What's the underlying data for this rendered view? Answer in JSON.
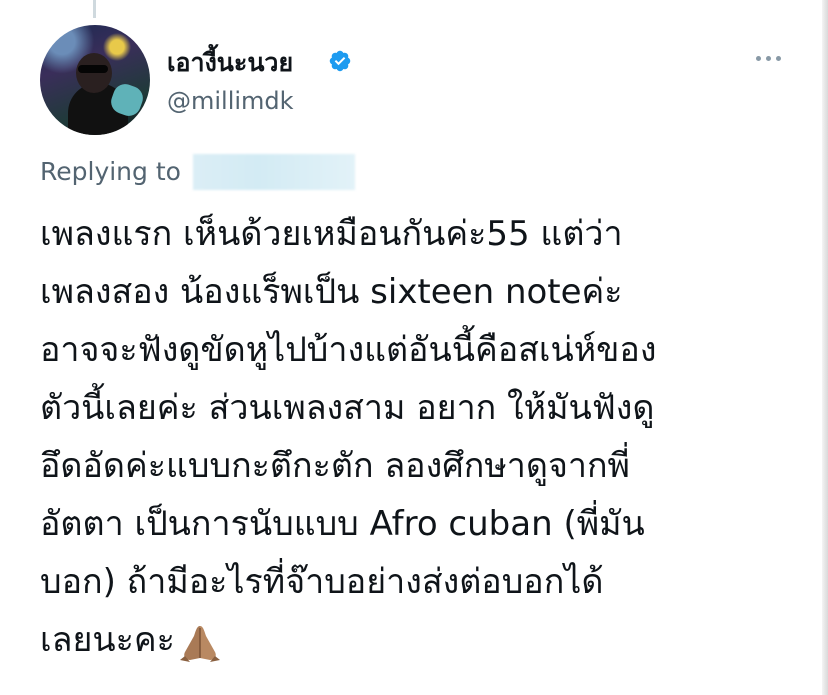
{
  "author": {
    "display_name": "เอางี้นะนวย",
    "handle": "@millimdk"
  },
  "reply": {
    "label": "Replying to"
  },
  "tweet": {
    "lines": [
      "เพลงแรก เห็นด้วยเหมือนกันค่ะ55 แต่ว่า",
      "เพลงสอง น้องแร็พเป็น sixteen noteค่ะ",
      "อาจจะฟังดูขัดหูไปบ้างแต่อันนี้คือสเน่ห์ของ",
      "ตัวนี้เลยค่ะ ส่วนเพลงสาม อยาก ให้มันฟังดู",
      "อึดอัดค่ะแบบกะตึกะตัก ลองศึกษาดูจากพี่",
      "อัตตา เป็นการนับแบบ Afro cuban (พี่มัน",
      "บอก) ถ้ามีอะไรที่จ๊าบอย่างส่งต่อบอกได้",
      "เลยนะคะ"
    ]
  },
  "colors": {
    "verified": "#1d9bf0",
    "secondary_text": "#536471"
  },
  "icons": [
    "verified-badge-icon",
    "more-options-icon",
    "folded-hands-emoji"
  ]
}
